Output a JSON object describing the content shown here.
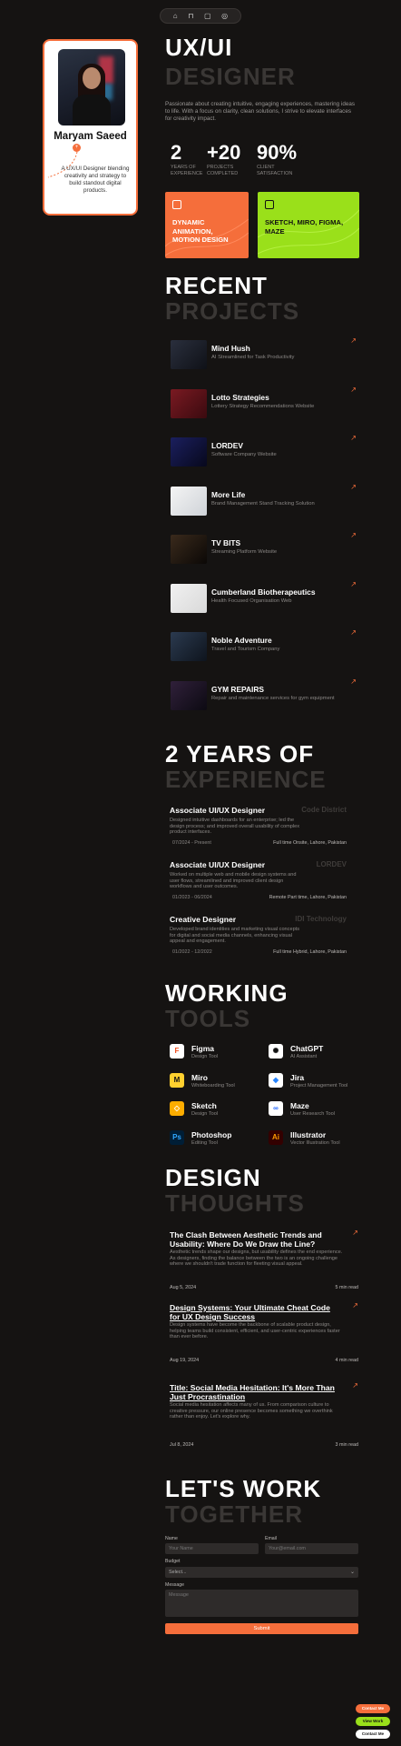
{
  "nav": {
    "icons": [
      "home-icon",
      "grid-icon",
      "briefcase-icon",
      "mail-icon"
    ],
    "glyphs": [
      "⌂",
      "⊓",
      "▢",
      "◎"
    ]
  },
  "profile": {
    "name": "Maryam Saeed",
    "badge": "+",
    "description": "A UX/UI Designer blending creativity and strategy to build standout digital products."
  },
  "hero": {
    "title_line1": "UX/UI",
    "title_line2": "DESIGNER",
    "intro": "Passionate about creating intuitive, engaging experiences, mastering ideas to life. With a focus on clarity, clean solutions, I strive to elevate interfaces for creativity impact.",
    "stats": [
      {
        "value": "2",
        "label": "YEARS OF\nEXPERIENCE"
      },
      {
        "value": "+20",
        "label": "PROJECTS\nCOMPLETED"
      },
      {
        "value": "90%",
        "label": "CLIENT\nSATISFACTION"
      }
    ],
    "cards": [
      {
        "text": "DYNAMIC ANIMATION, MOTION DESIGN",
        "icon": "layers-icon",
        "color": "#f56e3b"
      },
      {
        "text": "SKETCH, MIRO, FIGMA, MAZE",
        "icon": "layout-icon",
        "color": "#9ae01a"
      }
    ]
  },
  "projects": {
    "title_line1": "RECENT",
    "title_line2": "PROJECTS",
    "items": [
      {
        "title": "Mind Hush",
        "subtitle": "AI Streamlined for Task Productivity"
      },
      {
        "title": "Lotto Strategies",
        "subtitle": "Lottery Strategy Recommendations Website"
      },
      {
        "title": "LORDEV",
        "subtitle": "Software Company Website"
      },
      {
        "title": "More Life",
        "subtitle": "Brand Management Stand Tracking Solution"
      },
      {
        "title": "TV BITS",
        "subtitle": "Streaming Platform Website"
      },
      {
        "title": "Cumberland Biotherapeutics",
        "subtitle": "Health Focused Organisation Web"
      },
      {
        "title": "Noble Adventure",
        "subtitle": "Travel and Tourism Company"
      },
      {
        "title": "GYM REPAIRS",
        "subtitle": "Repair and maintenance services for gym equipment"
      }
    ]
  },
  "experience": {
    "title_line1": "2 YEARS OF",
    "title_line2": "EXPERIENCE",
    "items": [
      {
        "role": "Associate UI/UX Designer",
        "company": "Code District",
        "description": "Designed intuitive dashboards for an enterprise; led the design process; and improved overall usability of complex product interfaces.",
        "date": "07/2024 - Present",
        "location": "Full time Onsite, Lahore, Pakistan"
      },
      {
        "role": "Associate UI/UX Designer",
        "company": "LORDEV",
        "description": "Worked on multiple web and mobile design systems and user flows, streamlined and improved client design workflows and user outcomes.",
        "date": "01/2023 - 06/2024",
        "location": "Remote Part time, Lahore, Pakistan"
      },
      {
        "role": "Creative Designer",
        "company": "IDI Technology",
        "description": "Developed brand identities and marketing visual concepts for digital and social media channels, enhancing visual appeal and engagement.",
        "date": "01/2022 - 12/2022",
        "location": "Full time Hybrid, Lahore, Pakistan"
      }
    ]
  },
  "tools": {
    "title_line1": "WORKING",
    "title_line2": "TOOLS",
    "items": [
      {
        "name": "Figma",
        "subtitle": "Design Tool",
        "glyph": "F",
        "icon": "figma-icon",
        "bg": "#ffffff",
        "fg": "#f24e1e"
      },
      {
        "name": "ChatGPT",
        "subtitle": "AI Assistant",
        "glyph": "✺",
        "icon": "chatgpt-icon",
        "bg": "#ffffff",
        "fg": "#111111"
      },
      {
        "name": "Miro",
        "subtitle": "Whiteboarding Tool",
        "glyph": "M",
        "icon": "miro-icon",
        "bg": "#ffd02f",
        "fg": "#111111"
      },
      {
        "name": "Jira",
        "subtitle": "Project Management Tool",
        "glyph": "◆",
        "icon": "jira-icon",
        "bg": "#ffffff",
        "fg": "#2684ff"
      },
      {
        "name": "Sketch",
        "subtitle": "Design Tool",
        "glyph": "◇",
        "icon": "sketch-icon",
        "bg": "#fdad00",
        "fg": "#ffffff"
      },
      {
        "name": "Maze",
        "subtitle": "User Research Tool",
        "glyph": "∞",
        "icon": "maze-icon",
        "bg": "#ffffff",
        "fg": "#2266ff"
      },
      {
        "name": "Photoshop",
        "subtitle": "Editing Tool",
        "glyph": "Ps",
        "icon": "photoshop-icon",
        "bg": "#001e36",
        "fg": "#31a8ff"
      },
      {
        "name": "Illustrator",
        "subtitle": "Vector Illustration Tool",
        "glyph": "Ai",
        "icon": "illustrator-icon",
        "bg": "#330000",
        "fg": "#ff9a00"
      }
    ]
  },
  "thoughts": {
    "title_line1": "DESIGN",
    "title_line2": "THOUGHTS",
    "items": [
      {
        "title": "The Clash Between Aesthetic Trends and Usability: Where Do We Draw the Line?",
        "description": "Aesthetic trends shape our designs, but usability defines the end experience. As designers, finding the balance between the two is an ongoing challenge where we shouldn't trade function for fleeting visual appeal.",
        "date": "Aug 5, 2024",
        "read": "5 min read"
      },
      {
        "title": "Design Systems: Your Ultimate Cheat Code for UX Design Success",
        "description": "Design systems have become the backbone of scalable product design, helping teams build consistent, efficient, and user-centric experiences faster than ever before.",
        "date": "Aug 19, 2024",
        "read": "4 min read"
      },
      {
        "title": "Title: Social Media Hesitation: It's More Than Just Procrastination",
        "description": "Social media hesitation affects many of us. From comparison culture to creative pressure, our online presence becomes something we overthink rather than enjoy. Let's explore why.",
        "date": "Jul 8, 2024",
        "read": "3 min read"
      }
    ]
  },
  "contact": {
    "title_line1": "LET'S WORK",
    "title_line2": "TOGETHER",
    "name_label": "Name",
    "name_placeholder": "Your Name",
    "email_label": "Email",
    "email_placeholder": "Your@email.com",
    "budget_label": "Budget",
    "budget_value": "Select...",
    "message_label": "Message",
    "message_placeholder": "Message",
    "submit_label": "Submit"
  },
  "floating": [
    {
      "label": "Contact Me",
      "color": "#f56e3b",
      "text": "#ffffff"
    },
    {
      "label": "View Work",
      "color": "#9ae01a",
      "text": "#111111"
    },
    {
      "label": "Contact Me",
      "color": "#ffffff",
      "text": "#111111"
    }
  ],
  "colors": {
    "accent": "#f56e3b",
    "lime": "#9ae01a",
    "bg": "#151312"
  }
}
